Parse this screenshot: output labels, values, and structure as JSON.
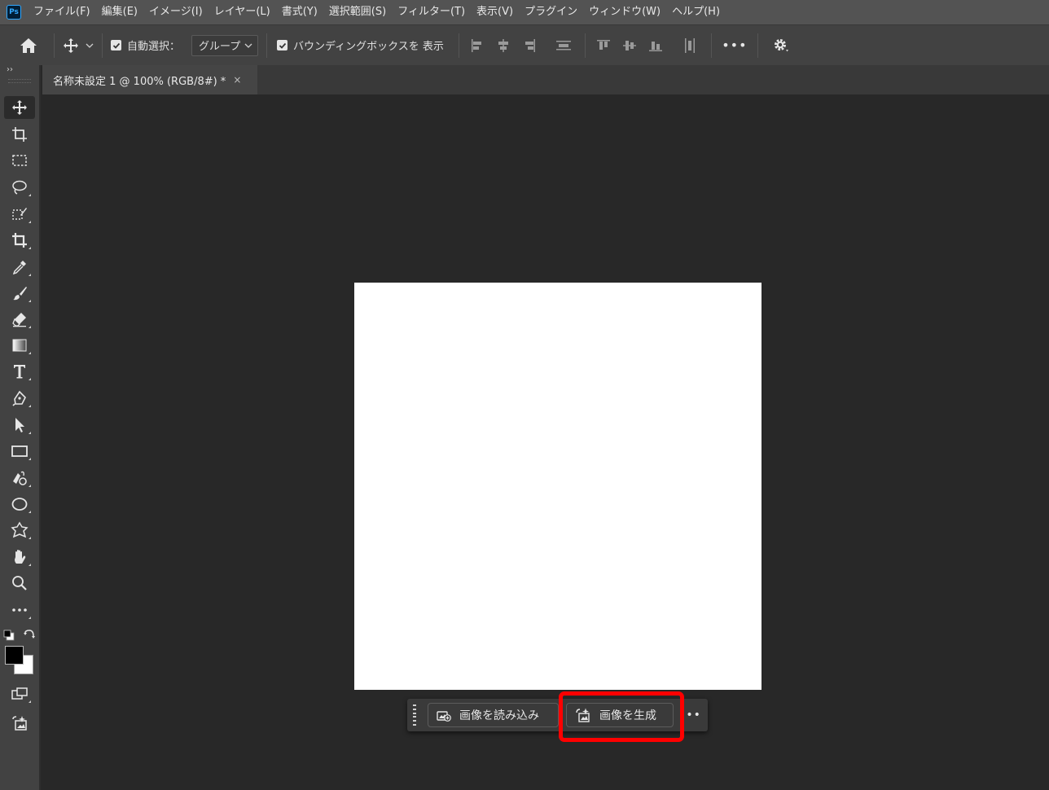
{
  "app": {
    "logo_text": "Ps",
    "accent": "#31a8ff"
  },
  "menu": [
    "ファイル(F)",
    "編集(E)",
    "イメージ(I)",
    "レイヤー(L)",
    "書式(Y)",
    "選択範囲(S)",
    "フィルター(T)",
    "表示(V)",
    "プラグイン",
    "ウィンドウ(W)",
    "ヘルプ(H)"
  ],
  "options": {
    "auto_select_label": "自動選択：",
    "auto_select_checked": true,
    "auto_select_mode": "グループ",
    "bounding_box_label": "バウンディングボックスを 表示",
    "bounding_box_checked": true
  },
  "document_tab": {
    "title": "名称未設定 1 @ 100% (RGB/8#) *",
    "close": "×"
  },
  "toolbar": {
    "collapse_glyph": "››",
    "tools": [
      "move-tool",
      "artboard-tool",
      "marquee-tool",
      "lasso-tool",
      "object-selection-tool",
      "crop-tool",
      "eyedropper-tool",
      "brush-tool",
      "eraser-tool",
      "gradient-tool",
      "type-tool",
      "pen-tool",
      "path-selection-tool",
      "rectangle-tool",
      "paint-bucket-tool",
      "ellipse-tool",
      "custom-shape-tool",
      "hand-tool",
      "zoom-tool",
      "more-tools",
      "default-colors",
      "swap-colors",
      "color-swatches",
      "screen-mode",
      "generative-fill-tool"
    ],
    "foreground_color": "#000000",
    "background_color": "#ffffff"
  },
  "taskbar": {
    "import_label": "画像を読み込み",
    "generate_label": "画像を生成",
    "more_label": "•••",
    "highlight_color": "#ff0000"
  }
}
